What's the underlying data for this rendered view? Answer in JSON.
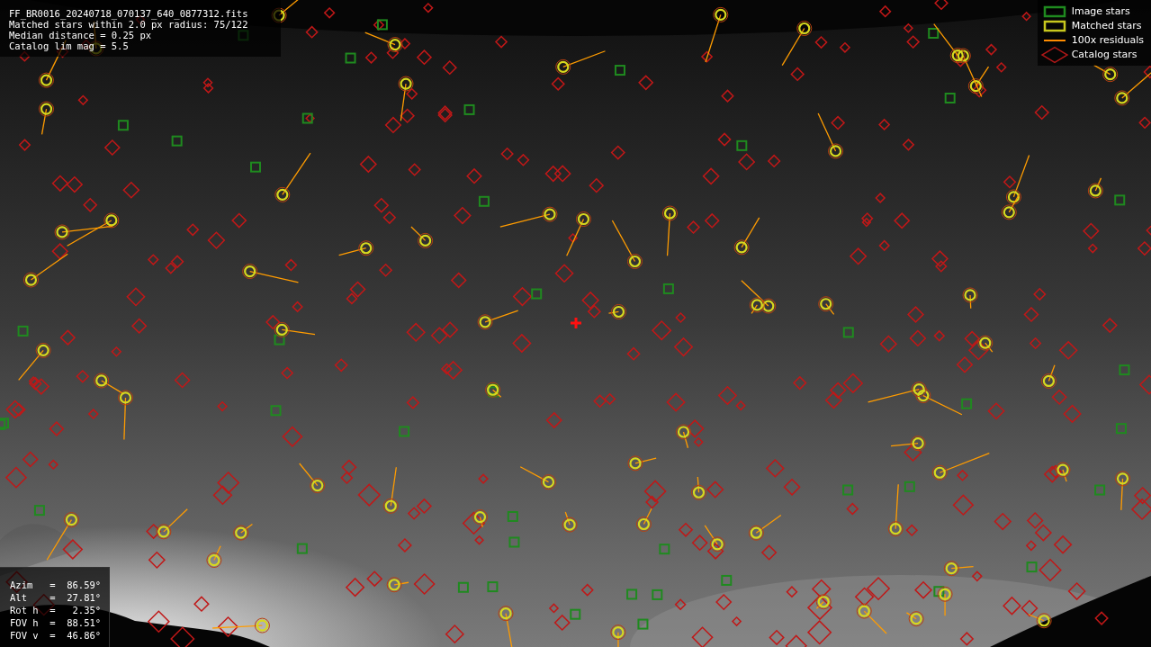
{
  "info_panel": {
    "lines": [
      "FF_BR0016_20240718_070137_640_0877312.fits",
      "Matched stars within 2.0 px radius: 75/122",
      "Median distance = 0.25 px",
      "Catalog lim mag = 5.5"
    ]
  },
  "legend": [
    {
      "kind": "square",
      "color": "#1f8a1f",
      "label": "Image stars"
    },
    {
      "kind": "square",
      "color": "#c8c81e",
      "label": "Matched stars"
    },
    {
      "kind": "line",
      "color": "#ff8c00",
      "label": "100x residuals"
    },
    {
      "kind": "diamond",
      "color": "#b01818",
      "label": "Catalog stars"
    }
  ],
  "pointing_panel": {
    "lines": [
      "Azim   =  86.59°",
      "Alt    =  27.81°",
      "Rot h  =   2.35°",
      "FOV h  =  88.51°",
      "FOV v  =  46.86°"
    ]
  }
}
